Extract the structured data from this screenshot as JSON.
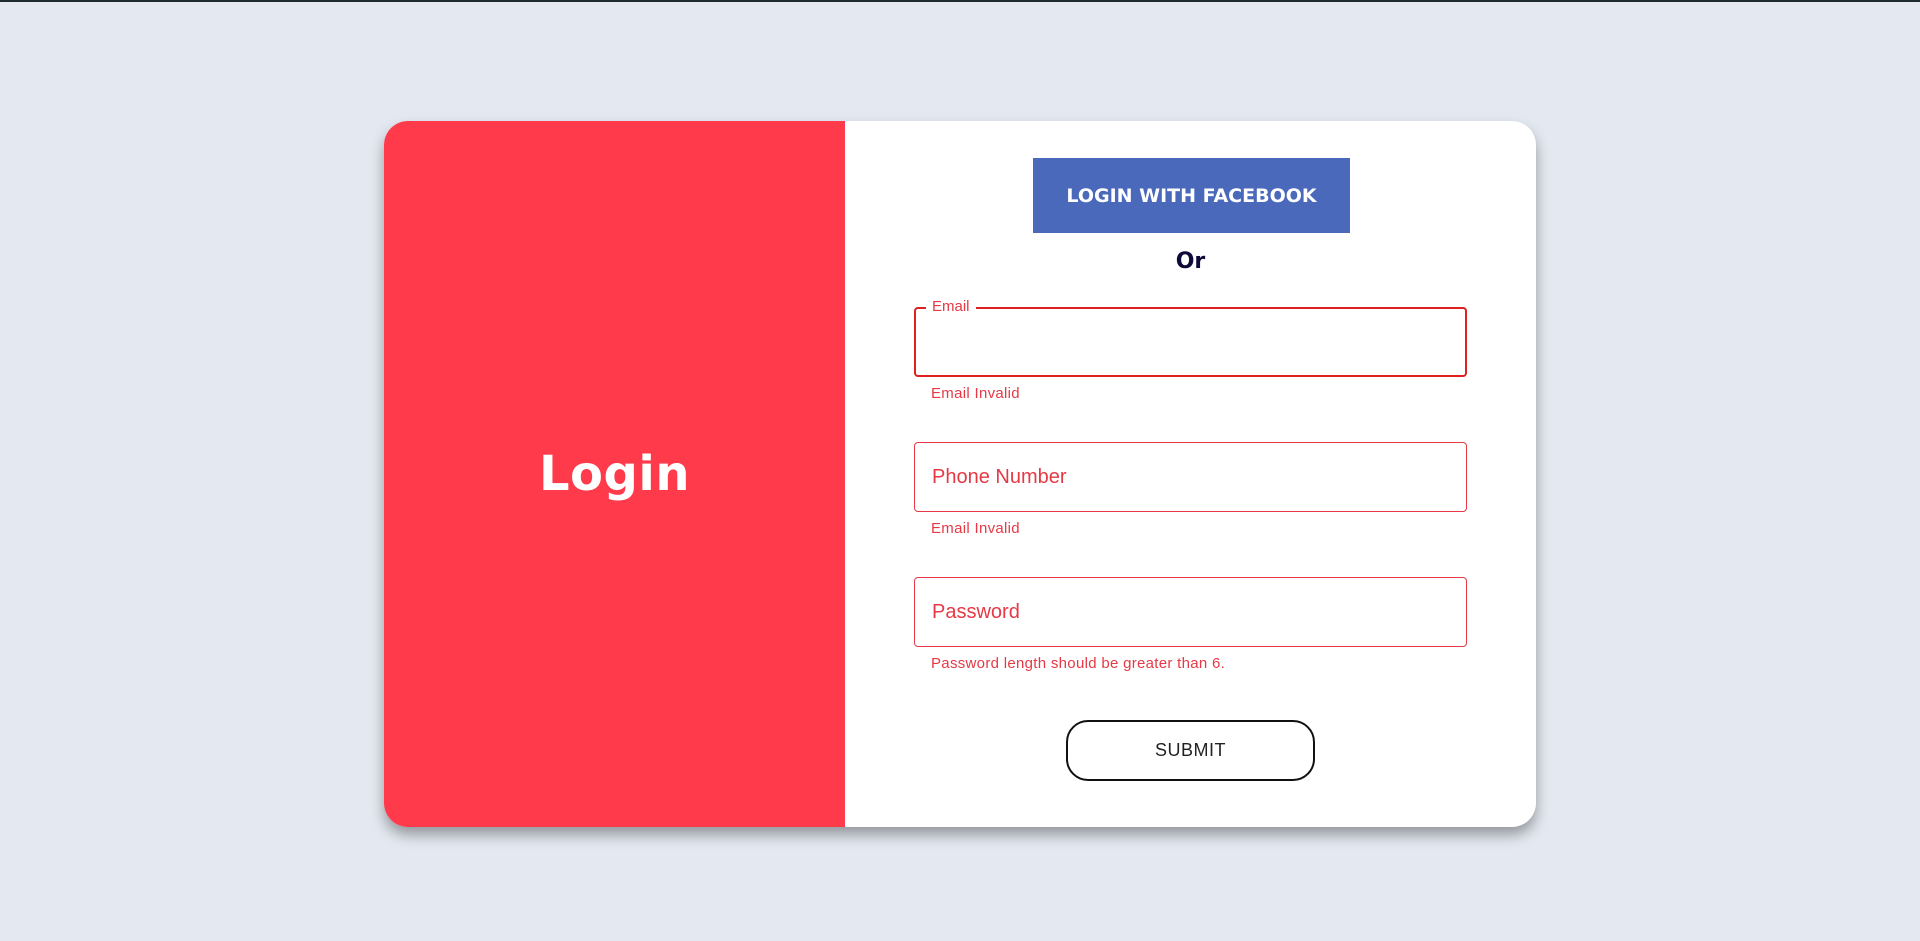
{
  "left_panel": {
    "title": "Login"
  },
  "social": {
    "facebook_label": "LOGIN WITH FACEBOOK",
    "facebook_color": "#4a69bb"
  },
  "divider": {
    "text": "Or"
  },
  "form": {
    "email": {
      "label": "Email",
      "value": "",
      "error": "Email Invalid"
    },
    "phone": {
      "placeholder": "Phone Number",
      "value": "",
      "error": "Email Invalid"
    },
    "password": {
      "placeholder": "Password",
      "value": "",
      "error": "Password length should be greater than 6."
    },
    "submit_label": "SUBMIT"
  },
  "colors": {
    "accent": "#ff3a4b",
    "error": "#e53945",
    "background": "#e4e9f1"
  }
}
